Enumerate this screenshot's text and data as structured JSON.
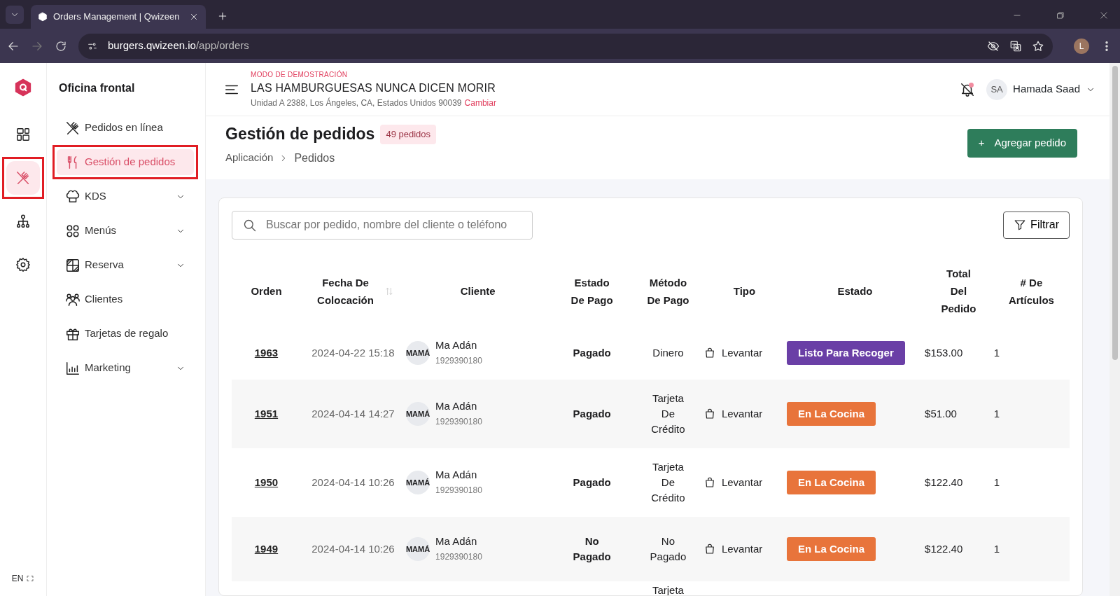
{
  "browser": {
    "tab_title": "Orders Management | Qwizeen",
    "url_host": "burgers.qwizeen.io",
    "url_path": "/app/orders",
    "profile_initial": "L"
  },
  "rail": {
    "items": [
      {
        "selected": false,
        "highlighted": false
      },
      {
        "selected": true,
        "highlighted": true
      },
      {
        "selected": false,
        "highlighted": false
      },
      {
        "selected": false,
        "highlighted": false
      }
    ],
    "language": "EN"
  },
  "sidebar": {
    "title": "Oficina frontal",
    "items": [
      {
        "label": "Pedidos en línea",
        "selected": false,
        "expandable": false,
        "highlighted": false
      },
      {
        "label": "Gestión de pedidos",
        "selected": true,
        "expandable": false,
        "highlighted": true
      },
      {
        "label": "KDS",
        "selected": false,
        "expandable": true,
        "highlighted": false
      },
      {
        "label": "Menús",
        "selected": false,
        "expandable": true,
        "highlighted": false
      },
      {
        "label": "Reserva",
        "selected": false,
        "expandable": true,
        "highlighted": false
      },
      {
        "label": "Clientes",
        "selected": false,
        "expandable": false,
        "highlighted": false
      },
      {
        "label": "Tarjetas de regalo",
        "selected": false,
        "expandable": false,
        "highlighted": false
      },
      {
        "label": "Marketing",
        "selected": false,
        "expandable": true,
        "highlighted": false
      }
    ]
  },
  "header": {
    "demo_label": "MODO DE DEMOSTRACIÓN",
    "restaurant": "LAS HAMBURGUESAS NUNCA DICEN MORIR",
    "address": "Unidad A 2388, Los Ángeles, CA, Estados Unidos 90039",
    "change_link": "Cambiar",
    "user_initials": "SA",
    "user_name": "Hamada Saad"
  },
  "page": {
    "title": "Gestión de pedidos",
    "count_badge": "49 pedidos",
    "breadcrumb": [
      "Aplicación",
      "Pedidos"
    ],
    "add_button": "Agregar pedido",
    "add_icon": "+"
  },
  "toolbar": {
    "search_placeholder": "Buscar por pedido, nombre del cliente o teléfono",
    "filter_button": "Filtrar"
  },
  "table": {
    "columns": [
      {
        "label": "Orden",
        "sortable": false
      },
      {
        "label": "Fecha De Colocación",
        "sortable": true
      },
      {
        "label": "Cliente",
        "sortable": false
      },
      {
        "label": "Estado De Pago",
        "sortable": false
      },
      {
        "label": "Método De Pago",
        "sortable": false
      },
      {
        "label": "Tipo",
        "sortable": false
      },
      {
        "label": "Estado",
        "sortable": false
      },
      {
        "label": "Total Del Pedido",
        "sortable": false
      },
      {
        "label": "# De Artículos",
        "sortable": false
      }
    ],
    "rows": [
      {
        "order": "1963",
        "date": "2024-04-22 15:18",
        "avatar": "MAMÁ",
        "customer": "Ma Adán",
        "phone": "1929390180",
        "payment_status": "Pagado",
        "payment_method": "Dinero",
        "type": "Levantar",
        "status": "Listo Para Recoger",
        "color": "#6a3fa6",
        "total": "$153.00",
        "items": "1"
      },
      {
        "order": "1951",
        "date": "2024-04-14 14:27",
        "avatar": "MAMÁ",
        "customer": "Ma Adán",
        "phone": "1929390180",
        "payment_status": "Pagado",
        "payment_method": "Tarjeta De Crédito",
        "type": "Levantar",
        "status": "En La Cocina",
        "color": "#e8743b",
        "total": "$51.00",
        "items": "1"
      },
      {
        "order": "1950",
        "date": "2024-04-14 10:26",
        "avatar": "MAMÁ",
        "customer": "Ma Adán",
        "phone": "1929390180",
        "payment_status": "Pagado",
        "payment_method": "Tarjeta De Crédito",
        "type": "Levantar",
        "status": "En La Cocina",
        "color": "#e8743b",
        "total": "$122.40",
        "items": "1"
      },
      {
        "order": "1949",
        "date": "2024-04-14 10:26",
        "avatar": "MAMÁ",
        "customer": "Ma Adán",
        "phone": "1929390180",
        "payment_status": "No Pagado",
        "payment_method": "No Pagado",
        "type": "Levantar",
        "status": "En La Cocina",
        "color": "#e8743b",
        "total": "$122.40",
        "items": "1"
      },
      {
        "payment_method": "Tarjeta"
      }
    ]
  }
}
